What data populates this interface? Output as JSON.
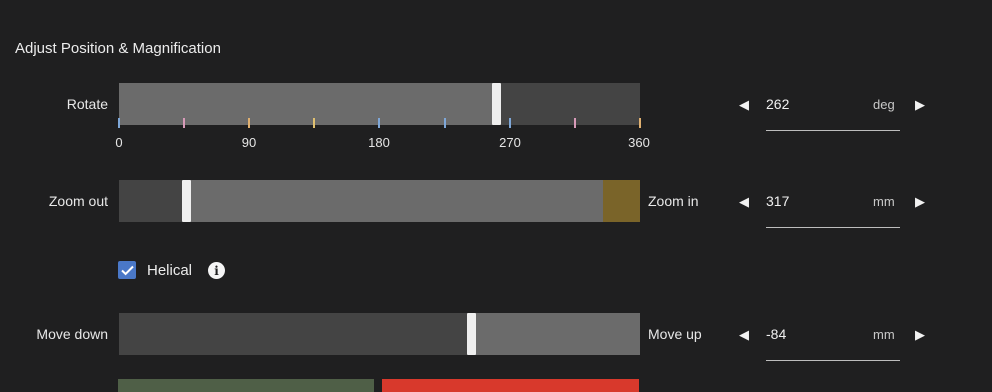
{
  "panel": {
    "title": "Adjust Position & Magnification"
  },
  "rotate": {
    "label": "Rotate",
    "ticks": [
      "0",
      "90",
      "180",
      "270",
      "360"
    ],
    "value": "262",
    "unit": "deg",
    "range": [
      0,
      360
    ],
    "level": 262
  },
  "zoom": {
    "left_label": "Zoom out",
    "right_label": "Zoom in",
    "value": "317",
    "unit": "mm",
    "handle_fraction": 0.13
  },
  "helical": {
    "label": "Helical",
    "checked": true
  },
  "move": {
    "left_label": "Move down",
    "right_label": "Move up",
    "value": "-84",
    "unit": "mm",
    "handle_fraction": 0.67
  },
  "arrows": {
    "left": "◀",
    "right": "▶"
  },
  "info_glyph": "i",
  "colors": {
    "background": "#1f1f20",
    "track_light": "#6b6b6b",
    "track_dark": "#444444",
    "zoom_end": "#7a6429",
    "checkbox": "#4a78c8",
    "button_green": "#4f5f47",
    "button_red": "#d8392c"
  }
}
